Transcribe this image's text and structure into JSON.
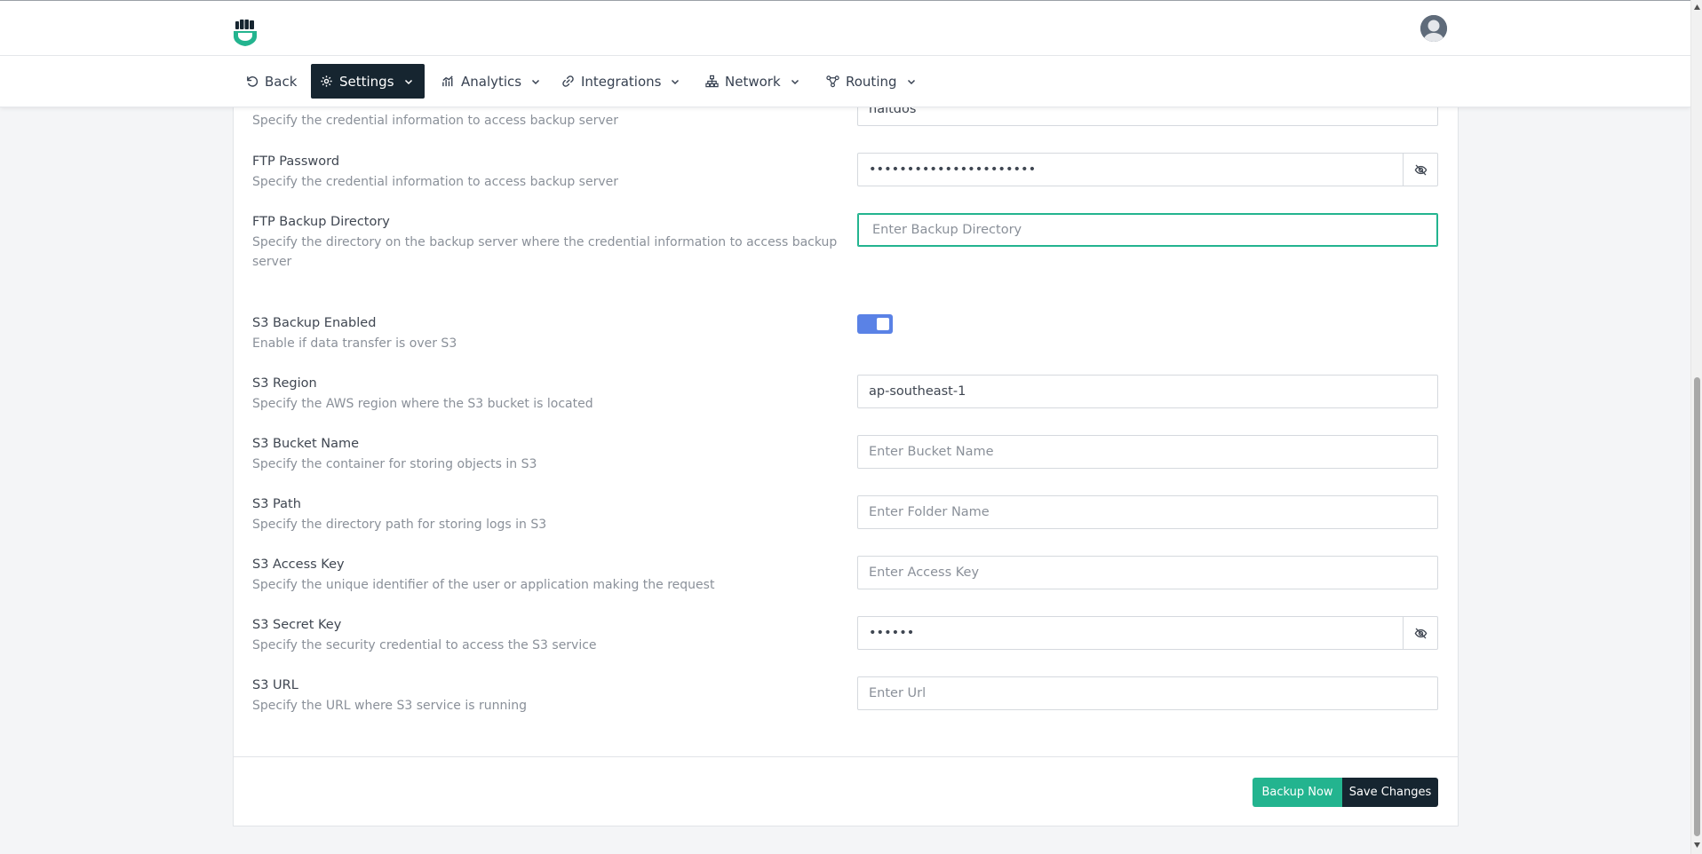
{
  "brand": {
    "accent": "#23b48f",
    "dark": "#162530",
    "toggle_color": "#5a82e6"
  },
  "nav": {
    "back": "Back",
    "settings": "Settings",
    "analytics": "Analytics",
    "integrations": "Integrations",
    "network": "Network",
    "routing": "Routing"
  },
  "form": {
    "ftp_username": {
      "value": "haltdos",
      "desc": "Specify the credential information to access backup server"
    },
    "ftp_password": {
      "label": "FTP Password",
      "desc": "Specify the credential information to access backup server",
      "value": "••••••••••••••••••••••"
    },
    "ftp_backup_dir": {
      "label": "FTP Backup Directory",
      "desc": "Specify the directory on the backup server where the credential information to access backup server",
      "placeholder": "Enter Backup Directory"
    },
    "s3_enabled": {
      "label": "S3 Backup Enabled",
      "desc": "Enable if data transfer is over S3",
      "on": true
    },
    "s3_region": {
      "label": "S3 Region",
      "desc": "Specify the AWS region where the S3 bucket is located",
      "value": "ap-southeast-1"
    },
    "s3_bucket": {
      "label": "S3 Bucket Name",
      "desc": "Specify the container for storing objects in S3",
      "placeholder": "Enter Bucket Name"
    },
    "s3_path": {
      "label": "S3 Path",
      "desc": "Specify the directory path for storing logs in S3",
      "placeholder": "Enter Folder Name"
    },
    "s3_access_key": {
      "label": "S3 Access Key",
      "desc": "Specify the unique identifier of the user or application making the request",
      "placeholder": "Enter Access Key"
    },
    "s3_secret_key": {
      "label": "S3 Secret Key",
      "desc": "Specify the security credential to access the S3 service",
      "value": "••••••"
    },
    "s3_url": {
      "label": "S3 URL",
      "desc": "Specify the URL where S3 service is running",
      "placeholder": "Enter Url"
    }
  },
  "actions": {
    "backup": "Backup Now",
    "save": "Save Changes"
  },
  "icons": {
    "logo": "fist-shield-logo",
    "back": "undo-icon",
    "settings": "gear-icon",
    "analytics": "chart-icon",
    "integrations": "link-icon",
    "network": "network-icon",
    "routing": "routing-icon",
    "reveal": "eye-slash-icon"
  }
}
